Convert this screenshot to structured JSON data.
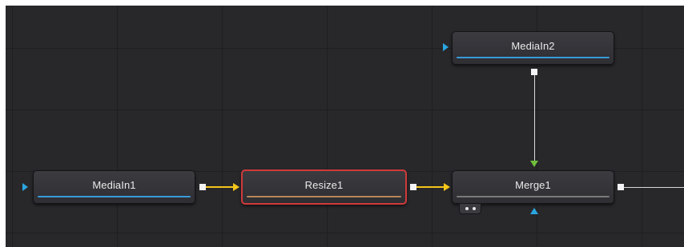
{
  "nodes": {
    "mediain1": {
      "label": "MediaIn1",
      "bar_color": "#3a9ad9"
    },
    "resize1": {
      "label": "Resize1",
      "bar_color": "#b9865a",
      "selected": true
    },
    "merge1": {
      "label": "Merge1",
      "bar_color": "#7a7a7a"
    },
    "mediain2": {
      "label": "MediaIn2",
      "bar_color": "#3a9ad9"
    }
  },
  "colors": {
    "canvas_bg": "#28282b",
    "grid": "#1f1f22",
    "selection_outline": "#d03a3a",
    "main_wire": "#f5c518",
    "effect_mask_input": "#2aa6e0",
    "foreground_input": "#6fbf3a",
    "output_wire": "#d8d8d8"
  },
  "icons": {
    "view_dots": "two-dot-view-indicator-icon"
  }
}
